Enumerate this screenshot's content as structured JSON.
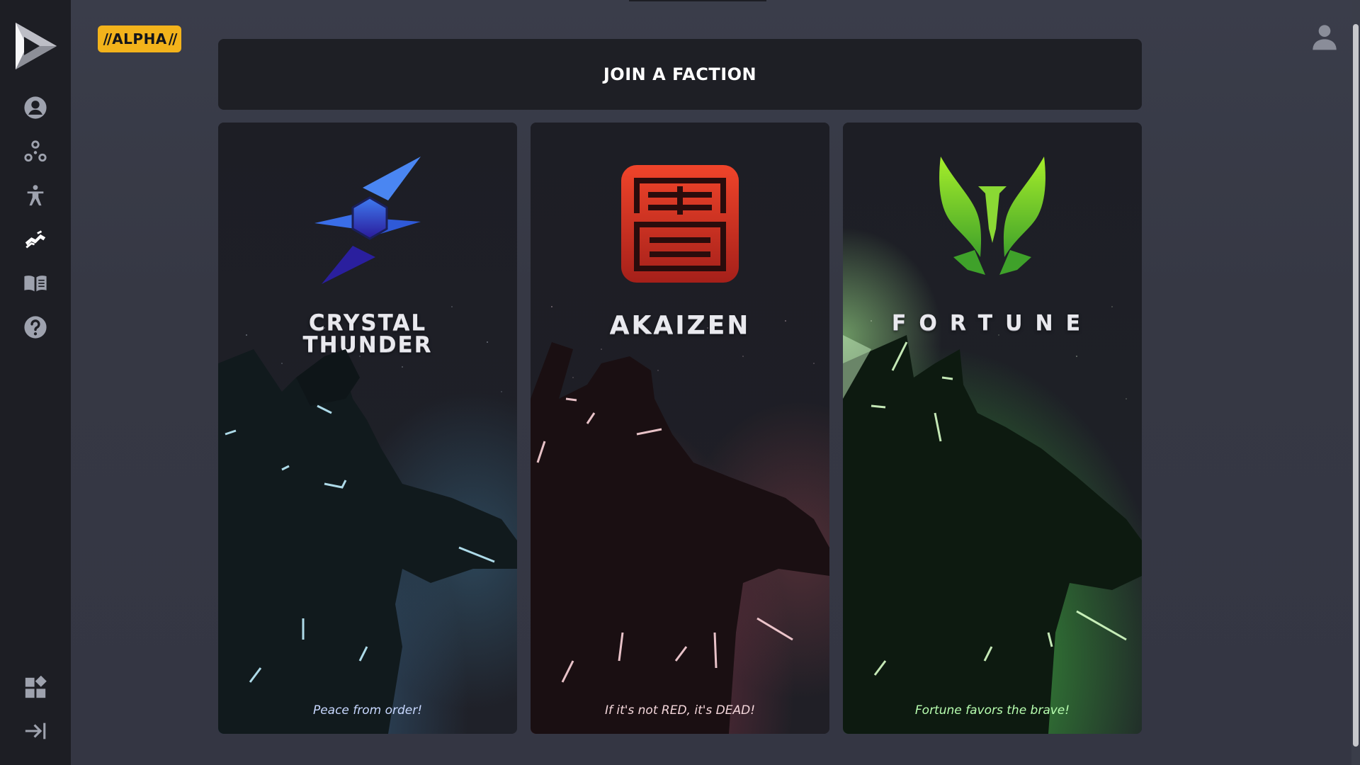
{
  "badge": {
    "label": "ALPHA"
  },
  "header": {
    "title": "JOIN A FACTION"
  },
  "factions": [
    {
      "name_line1": "CRYSTAL",
      "name_line2": "THUNDER",
      "motto": "Peace from order!",
      "accent": "#5aa8d6",
      "motto_color": "#c8d8ff"
    },
    {
      "name": "AKAIZEN",
      "motto": "If it's not RED, it's DEAD!",
      "accent": "#d34a5a",
      "motto_color": "#f3d6da"
    },
    {
      "name": "FORTUNE",
      "motto": "Fortune favors the brave!",
      "accent": "#7ee23c",
      "motto_color": "#b8ffb0"
    }
  ],
  "sidebar": {
    "items": [
      {
        "icon": "profile-icon"
      },
      {
        "icon": "network-icon"
      },
      {
        "icon": "person-figure-icon"
      },
      {
        "icon": "faction-handshake-icon",
        "active": true
      },
      {
        "icon": "book-icon"
      },
      {
        "icon": "help-icon"
      }
    ],
    "bottom": [
      {
        "icon": "widgets-icon"
      },
      {
        "icon": "collapse-arrow-icon"
      }
    ]
  },
  "colors": {
    "sidebar": "#1d1e24",
    "header_bg": "#1e1f25",
    "badge": "#f3b31b",
    "icon": "#9ea2ae"
  }
}
